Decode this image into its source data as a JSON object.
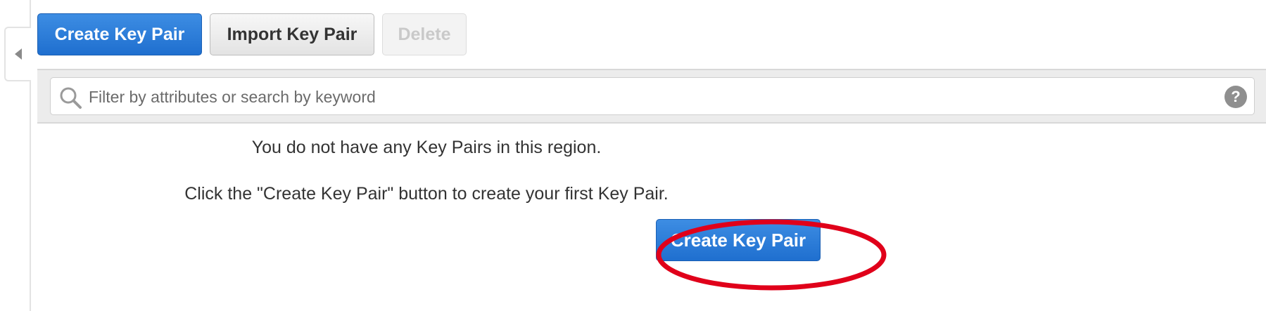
{
  "toolbar": {
    "create_label": "Create Key Pair",
    "import_label": "Import Key Pair",
    "delete_label": "Delete"
  },
  "filter": {
    "placeholder": "Filter by attributes or search by keyword",
    "help_glyph": "?"
  },
  "empty_state": {
    "line1": "You do not have any Key Pairs in this region.",
    "line2": "Click the \"Create Key Pair\" button to create your first Key Pair.",
    "cta_label": "Create Key Pair"
  },
  "icons": {
    "collapse": "chevron-left-icon",
    "search": "search-icon",
    "help": "help-icon"
  },
  "colors": {
    "primary": "#1f6fcf",
    "highlight": "#e0001a",
    "filter_band": "#ececec"
  }
}
